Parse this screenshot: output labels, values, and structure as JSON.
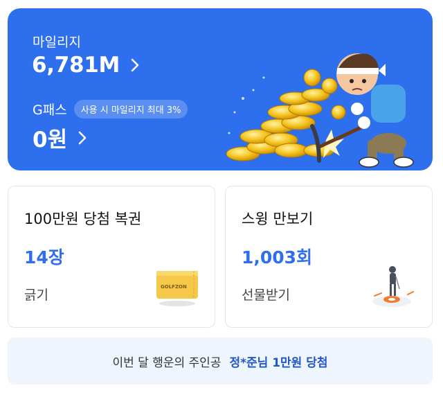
{
  "mileage": {
    "label": "마일리지",
    "value": "6,781M"
  },
  "gpass": {
    "label": "G패스",
    "badge": "사용 시 마일리지 최대 3%",
    "value": "0원"
  },
  "lottery": {
    "title": "100만원 당첨 복권",
    "count": "14장",
    "action": "긁기",
    "ticket_brand": "GOLFZON"
  },
  "pedometer": {
    "title": "스윙 만보기",
    "count": "1,003회",
    "action": "선물받기"
  },
  "banner": {
    "text": "이번 달 행운의 주인공",
    "winner": "정*준님 1만원 당첨"
  },
  "colors": {
    "accent": "#2d6fed",
    "banner_bg": "#eef5fd"
  },
  "icons": {
    "mileage_arrow": "chevron-right-icon",
    "gpass_arrow": "chevron-right-icon",
    "lottery": "golfzon-ticket-icon",
    "pedometer": "golfer-icon"
  }
}
